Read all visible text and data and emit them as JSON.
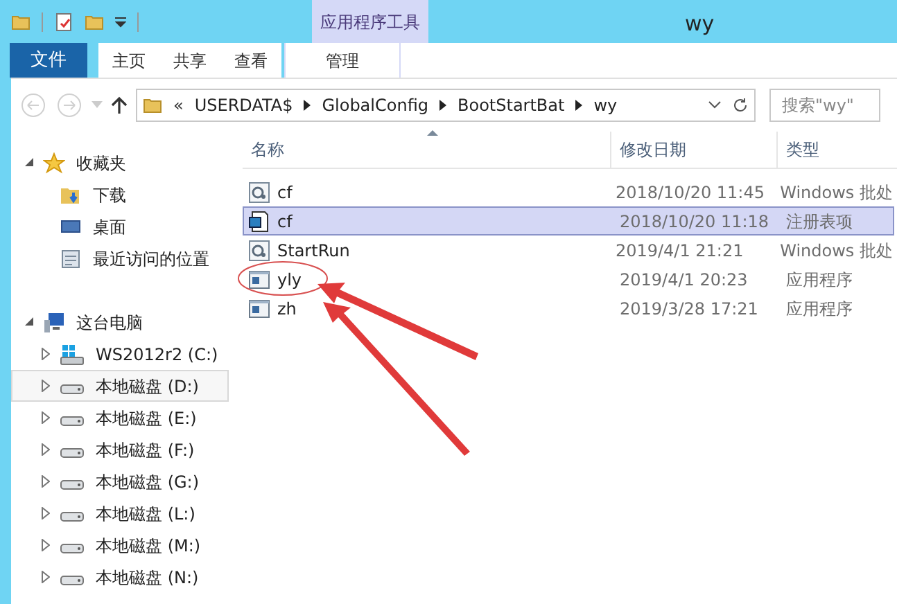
{
  "window": {
    "title": "wy",
    "context_tab": "应用程序工具"
  },
  "ribbon": {
    "tabs": [
      {
        "label": "文件",
        "kind": "file",
        "selected": false
      },
      {
        "label": "主页",
        "kind": "tab",
        "selected": false
      },
      {
        "label": "共享",
        "kind": "tab",
        "selected": false
      },
      {
        "label": "查看",
        "kind": "tab",
        "selected": false
      },
      {
        "label": "管理",
        "kind": "context",
        "selected": true
      }
    ]
  },
  "address": {
    "overflow": "«",
    "path": [
      "USERDATA$",
      "GlobalConfig",
      "BootStartBat",
      "wy"
    ]
  },
  "search": {
    "placeholder": "搜索\"wy\""
  },
  "sidebar": {
    "items": [
      {
        "label": "收藏夹",
        "kind": "star",
        "expanded": true,
        "selected": false,
        "children": [
          {
            "label": "下载",
            "kind": "download",
            "selected": false
          },
          {
            "label": "桌面",
            "kind": "desktop",
            "selected": false
          },
          {
            "label": "最近访问的位置",
            "kind": "recent",
            "selected": false
          }
        ]
      },
      {
        "label": "这台电脑",
        "kind": "computer",
        "expanded": true,
        "selected": false,
        "children": [
          {
            "label": "WS2012r2 (C:)",
            "kind": "system-drive",
            "expanded": false,
            "selected": false
          },
          {
            "label": "本地磁盘 (D:)",
            "kind": "drive",
            "expanded": false,
            "selected": true
          },
          {
            "label": "本地磁盘 (E:)",
            "kind": "drive",
            "expanded": false,
            "selected": false
          },
          {
            "label": "本地磁盘 (F:)",
            "kind": "drive",
            "expanded": false,
            "selected": false
          },
          {
            "label": "本地磁盘 (G:)",
            "kind": "drive",
            "expanded": false,
            "selected": false
          },
          {
            "label": "本地磁盘 (L:)",
            "kind": "drive",
            "expanded": false,
            "selected": false
          },
          {
            "label": "本地磁盘 (M:)",
            "kind": "drive",
            "expanded": false,
            "selected": false
          },
          {
            "label": "本地磁盘 (N:)",
            "kind": "drive",
            "expanded": false,
            "selected": false
          }
        ]
      }
    ]
  },
  "table": {
    "columns": [
      {
        "label": "名称",
        "sorted": true
      },
      {
        "label": "修改日期",
        "sorted": false
      },
      {
        "label": "类型",
        "sorted": false
      }
    ],
    "rows": [
      {
        "name": "cf",
        "kind": "batch",
        "date": "2018/10/20 11:45",
        "type": "Windows 批处",
        "selected": false,
        "circled": false
      },
      {
        "name": "cf",
        "kind": "registry",
        "date": "2018/10/20 11:18",
        "type": "注册表项",
        "selected": true,
        "circled": false
      },
      {
        "name": "StartRun",
        "kind": "batch",
        "date": "2019/4/1 21:21",
        "type": "Windows 批处",
        "selected": false,
        "circled": false
      },
      {
        "name": "yly",
        "kind": "app",
        "date": "2019/4/1 20:23",
        "type": "应用程序",
        "selected": false,
        "circled": true
      },
      {
        "name": "zh",
        "kind": "app",
        "date": "2019/3/28 17:21",
        "type": "应用程序",
        "selected": false,
        "circled": false
      }
    ]
  }
}
